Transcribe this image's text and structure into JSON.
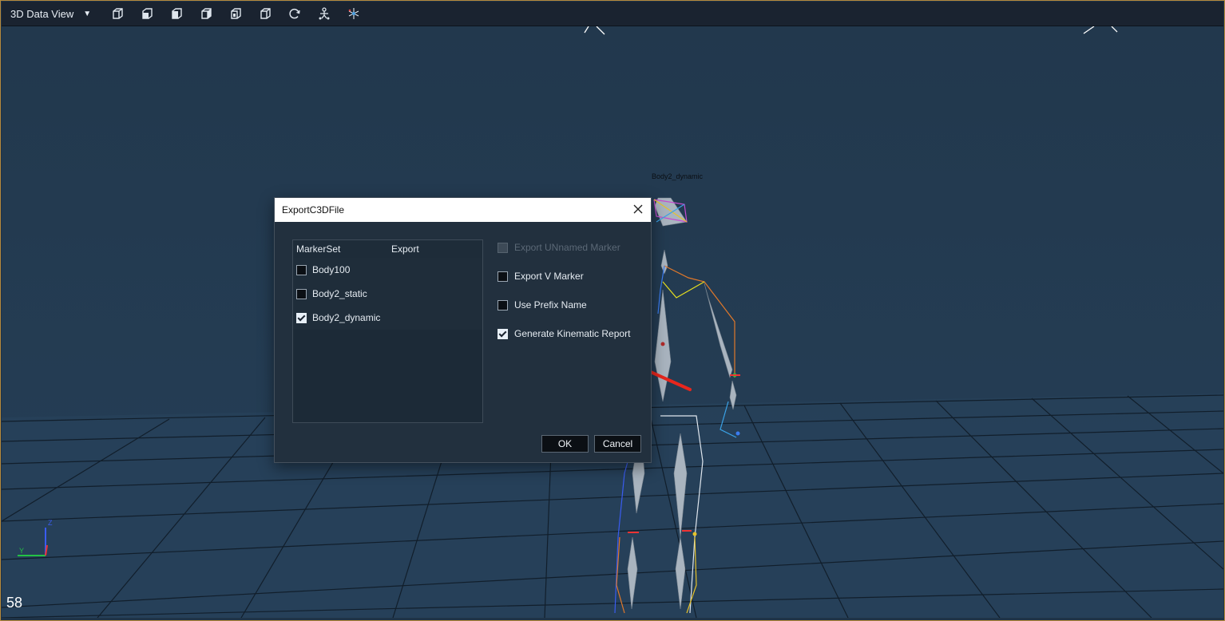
{
  "toolbar": {
    "title": "3D Data View",
    "dropdown_icon": "triangle-down-icon",
    "buttons": [
      "perspective-view-icon",
      "front-view-icon",
      "side-view-icon",
      "top-view-icon",
      "back-view-icon",
      "bottom-view-icon",
      "rotate-reset-icon",
      "skeleton-view-icon",
      "marker-view-icon"
    ]
  },
  "viewport": {
    "frame_number": "58",
    "figure_label": "Body2_dynamic"
  },
  "dialog": {
    "title": "ExportC3DFile",
    "table": {
      "headers": [
        "MarkerSet",
        "Export"
      ],
      "rows": [
        {
          "name": "Body100",
          "checked": false
        },
        {
          "name": "Body2_static",
          "checked": false
        },
        {
          "name": "Body2_dynamic",
          "checked": true
        }
      ]
    },
    "options": [
      {
        "label": "Export UNnamed Marker",
        "checked": false,
        "disabled": true
      },
      {
        "label": "Export V Marker",
        "checked": false,
        "disabled": false
      },
      {
        "label": "Use Prefix Name",
        "checked": false,
        "disabled": false
      },
      {
        "label": "Generate Kinematic Report",
        "checked": true,
        "disabled": false
      }
    ],
    "ok_label": "OK",
    "cancel_label": "Cancel"
  },
  "colors": {
    "viewport_bg": "#213a51",
    "dialog_bg": "#22303e",
    "annotation_arrow": "#e8261d",
    "frame_border": "#b78a3c"
  }
}
